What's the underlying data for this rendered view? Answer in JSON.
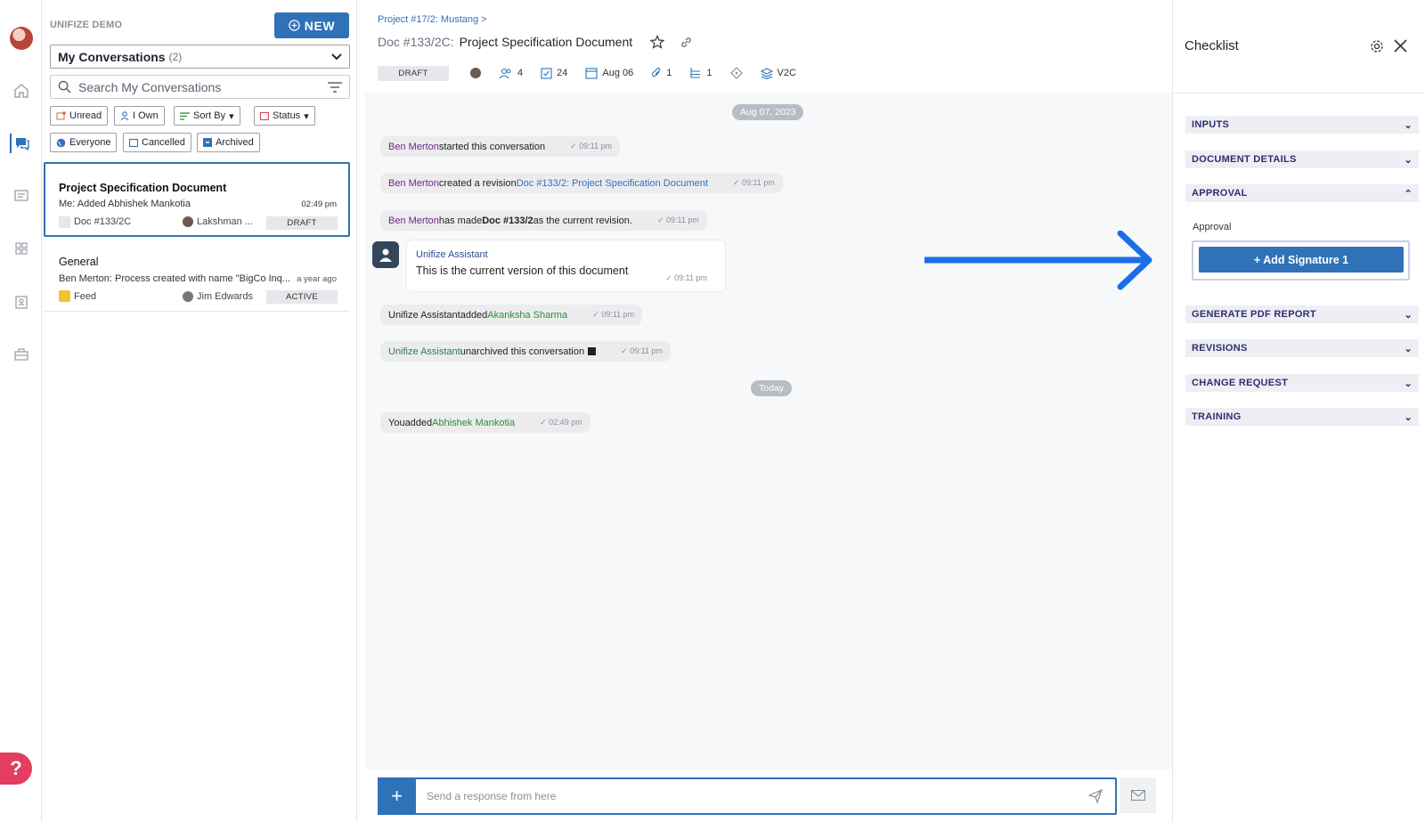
{
  "sidebar": {
    "help_label": "?"
  },
  "list": {
    "org": "UNIFIZE DEMO",
    "new_button": "NEW",
    "view_label": "My Conversations",
    "view_count": "(2)",
    "search_placeholder": "Search My Conversations",
    "chips": [
      "Unread",
      "I Own",
      "Sort By",
      "Status",
      "Everyone",
      "Cancelled",
      "Archived"
    ],
    "conversations": [
      {
        "title": "Project Specification Document",
        "subtitle": "Me: Added Abhishek Mankotia",
        "time": "02:49 pm",
        "ref": "Doc #133/2C",
        "owner": "Lakshman ...",
        "status": "DRAFT"
      },
      {
        "title": "General",
        "subtitle": "Ben Merton: Process created with name \"BigCo Inq...",
        "time": "a year ago",
        "ref": "Feed",
        "owner": "Jim Edwards",
        "status": "ACTIVE"
      }
    ]
  },
  "doc": {
    "breadcrumb": "Project #17/2: Mustang >",
    "prefix": "Doc #133/2C:",
    "title": "Project Specification Document",
    "status": "DRAFT",
    "members": "4",
    "checklist_count": "24",
    "due": "Aug 06",
    "attachments": "1",
    "children": "1",
    "version": "V2C"
  },
  "chat": {
    "date1": "Aug 07, 2023",
    "date2": "Today",
    "m1": {
      "user": "Ben Merton",
      "text": " started this conversation",
      "time": "09:11 pm"
    },
    "m2": {
      "user": "Ben Merton",
      "text": " created a revision ",
      "link": "Doc #133/2: Project Specification Document",
      "time": "09:11 pm"
    },
    "m3": {
      "user": "Ben Merton",
      "text1": " has made ",
      "bold": "Doc #133/2",
      "text2": " as the current revision.",
      "time": "09:11 pm"
    },
    "assistant": {
      "name": "Unifize Assistant",
      "body": "This is the current version of this document",
      "time": "09:11 pm"
    },
    "m4": {
      "user": "Unifize Assistant",
      "text": " added ",
      "target": "Akanksha Sharma",
      "time": "09:11 pm"
    },
    "m5": {
      "user": "Unifize Assistant",
      "text": " unarchived this conversation",
      "time": "09:11 pm"
    },
    "m6": {
      "user": "You",
      "text": " added ",
      "target": "Abhishek Mankotia",
      "time": "02:49 pm"
    },
    "composer_placeholder": "Send a response from here"
  },
  "checklist": {
    "title": "Checklist",
    "sections": [
      "INPUTS",
      "DOCUMENT DETAILS",
      "APPROVAL",
      "GENERATE PDF REPORT",
      "REVISIONS",
      "CHANGE REQUEST",
      "TRAINING"
    ],
    "approval_label": "Approval",
    "signature_button": "+ Add Signature 1"
  },
  "colors": {
    "accent": "#2f72b8",
    "arrow": "#1a6ee8",
    "user_purple": "#6b2a86",
    "added_green": "#2f8b3a"
  }
}
